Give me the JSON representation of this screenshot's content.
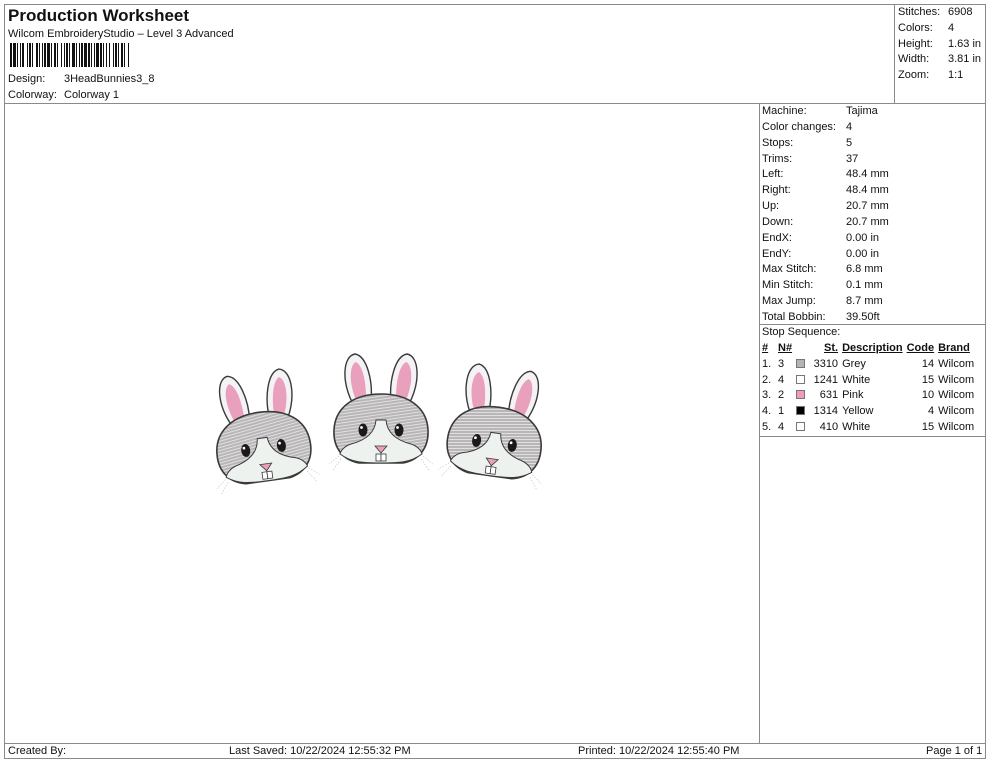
{
  "header": {
    "title": "Production Worksheet",
    "subtitle": "Wilcom EmbroideryStudio – Level 3 Advanced",
    "design_label": "Design:",
    "design_value": "3HeadBunnies3_8",
    "colorway_label": "Colorway:",
    "colorway_value": "Colorway 1"
  },
  "summary": [
    {
      "label": "Stitches:",
      "value": "6908"
    },
    {
      "label": "Colors:",
      "value": "4"
    },
    {
      "label": "Height:",
      "value": "1.63 in"
    },
    {
      "label": "Width:",
      "value": "3.81 in"
    },
    {
      "label": "Zoom:",
      "value": "1:1"
    }
  ],
  "machine_info": [
    {
      "label": "Machine:",
      "value": "Tajima"
    },
    {
      "label": "Color changes:",
      "value": "4"
    },
    {
      "label": "Stops:",
      "value": "5"
    },
    {
      "label": "Trims:",
      "value": "37"
    },
    {
      "label": "Left:",
      "value": "48.4 mm"
    },
    {
      "label": "Right:",
      "value": "48.4 mm"
    },
    {
      "label": "Up:",
      "value": "20.7 mm"
    },
    {
      "label": "Down:",
      "value": "20.7 mm"
    },
    {
      "label": "EndX:",
      "value": "0.00 in"
    },
    {
      "label": "EndY:",
      "value": "0.00 in"
    },
    {
      "label": "Max Stitch:",
      "value": "6.8 mm"
    },
    {
      "label": "Min Stitch:",
      "value": "0.1 mm"
    },
    {
      "label": "Max Jump:",
      "value": "8.7 mm"
    },
    {
      "label": "Total Bobbin:",
      "value": "39.50ft"
    }
  ],
  "stop_sequence": {
    "label": "Stop Sequence:",
    "headers": {
      "num": "#",
      "needle": "N#",
      "stitches": "St.",
      "description": "Description",
      "code": "Code",
      "brand": "Brand"
    },
    "rows": [
      {
        "num": "1.",
        "needle": "3",
        "color": "#b4b4b4",
        "stitches": "3310",
        "description": "Grey",
        "code": "14",
        "brand": "Wilcom"
      },
      {
        "num": "2.",
        "needle": "4",
        "color": "#ffffff",
        "stitches": "1241",
        "description": "White",
        "code": "15",
        "brand": "Wilcom"
      },
      {
        "num": "3.",
        "needle": "2",
        "color": "#f09ac0",
        "stitches": "631",
        "description": "Pink",
        "code": "10",
        "brand": "Wilcom"
      },
      {
        "num": "4.",
        "needle": "1",
        "color": "#000000",
        "stitches": "1314",
        "description": "Yellow",
        "code": "4",
        "brand": "Wilcom"
      },
      {
        "num": "5.",
        "needle": "4",
        "color": "#ffffff",
        "stitches": "410",
        "description": "White",
        "code": "15",
        "brand": "Wilcom"
      }
    ]
  },
  "design_preview": {
    "description": "Three embroidered bunny heads",
    "colors": {
      "grey": "#b9b6b8",
      "pink": "#e8a0bc",
      "outline": "#3a3a3a",
      "white": "#eef2ee"
    }
  },
  "footer": {
    "created_by": "Created By:",
    "last_saved": "Last Saved: 10/22/2024 12:55:32 PM",
    "printed": "Printed: 10/22/2024 12:55:40 PM",
    "page": "Page 1 of 1"
  }
}
